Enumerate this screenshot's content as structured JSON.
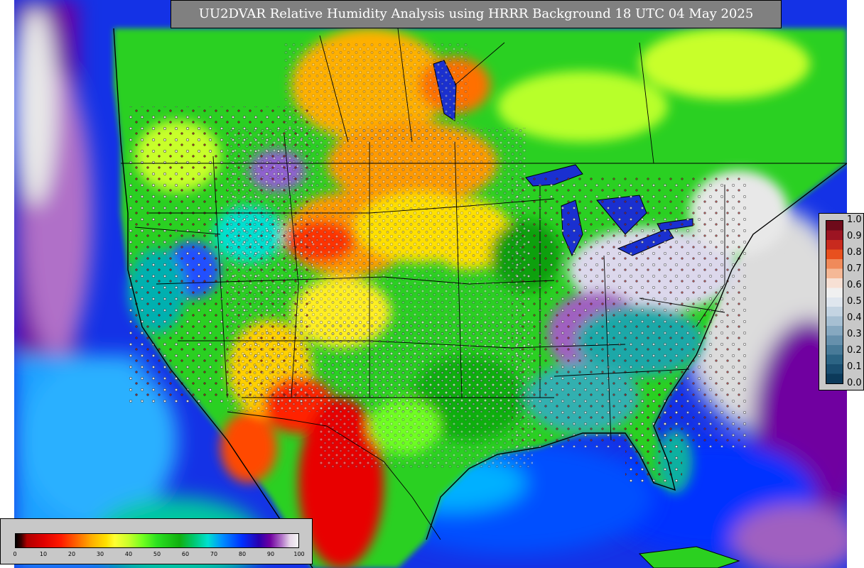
{
  "title": "UU2DVAR Relative Humidity Analysis using HRRR Background 18 UTC 04 May 2025",
  "colorbar_right": {
    "ticks": [
      "1.0",
      "0.9",
      "0.8",
      "0.7",
      "0.6",
      "0.5",
      "0.4",
      "0.3",
      "0.2",
      "0.1",
      "0.0"
    ],
    "colors": [
      "#6e0a1a",
      "#9c1422",
      "#c82a1e",
      "#e8501e",
      "#f08a5a",
      "#f5b896",
      "#f7e0d4",
      "#f0f0f0",
      "#dfe6ee",
      "#c4d4e2",
      "#a6bfd2",
      "#86a8c0",
      "#6690ac",
      "#487a98",
      "#2c6484",
      "#1a4e70",
      "#0c3a5a"
    ]
  },
  "colorbar_bottom": {
    "ticks": [
      "0",
      "10",
      "20",
      "30",
      "40",
      "50",
      "60",
      "70",
      "80",
      "90",
      "100"
    ]
  },
  "colors": {
    "land_bg": "#d4d4d4",
    "ocean_blue": "#1432e6",
    "frame_gray": "#c8c8c8",
    "title_bg": "#808080"
  }
}
